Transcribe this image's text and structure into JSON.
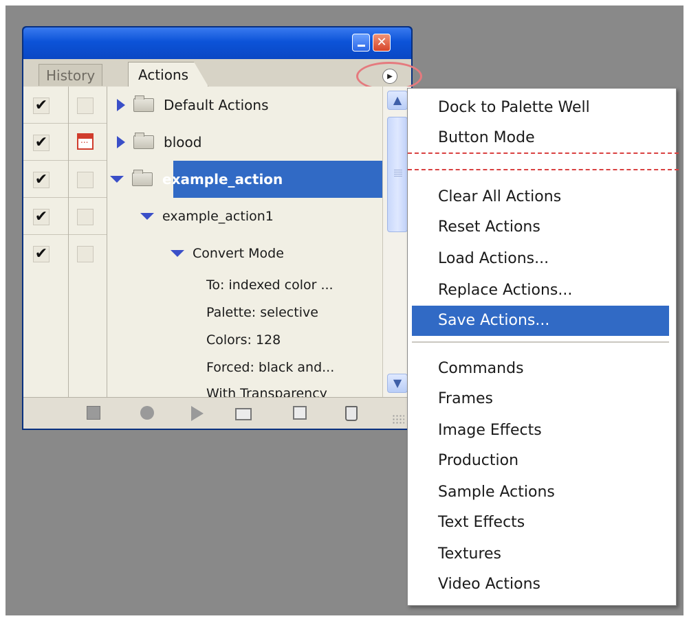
{
  "palette": {
    "tabs": [
      "History",
      "Actions"
    ],
    "title_buttons": {
      "minimize": "minimize",
      "close": "✕"
    },
    "flyout_button_icon": "circle-arrow-right-icon",
    "action_rows": [
      {
        "label": "Default Actions",
        "checked": true,
        "dialog": false,
        "expanded": false,
        "selected": false
      },
      {
        "label": "blood",
        "checked": true,
        "dialog": true,
        "expanded": false,
        "selected": false
      },
      {
        "label": "example_action",
        "checked": true,
        "dialog": false,
        "expanded": true,
        "selected": true
      },
      {
        "label": "example_action1",
        "checked": true,
        "dialog": false,
        "expanded": true,
        "selected": false
      },
      {
        "label": "Convert Mode",
        "checked": true,
        "dialog": false,
        "expanded": true,
        "selected": false
      }
    ],
    "step_details": [
      "To: indexed color ...",
      "Palette: selective",
      "Colors: 128",
      "Forced: black and...",
      "With Transparency"
    ],
    "check_mark": "✔",
    "toolbar_icons": [
      "stop-icon",
      "record-icon",
      "play-icon",
      "new-set-icon",
      "new-action-icon",
      "trash-icon"
    ]
  },
  "menu": {
    "group1": [
      "Dock to Palette Well",
      "Button Mode"
    ],
    "group2": [
      "Clear All Actions",
      "Reset Actions",
      "Load Actions...",
      "Replace Actions...",
      "Save Actions..."
    ],
    "group3": [
      "Commands",
      "Frames",
      "Image Effects",
      "Production",
      "Sample Actions",
      "Text Effects",
      "Textures",
      "Video Actions"
    ],
    "active_item": "Save Actions..."
  },
  "colors": {
    "selection": "#316ac5",
    "title_bar": "#0c53d8",
    "annotation": "#d94040",
    "desktop": "#898989"
  }
}
